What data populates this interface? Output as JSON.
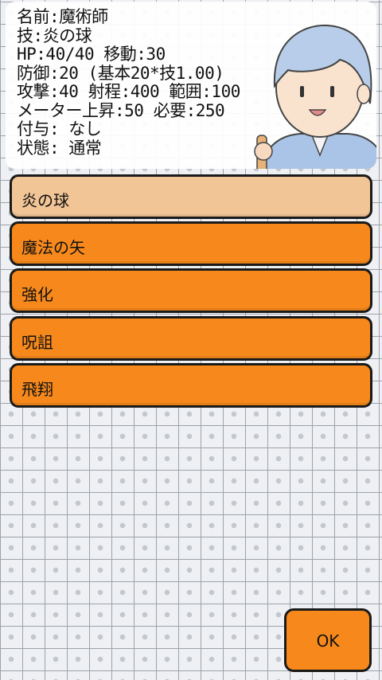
{
  "stats": [
    "名前:魔術師",
    "技:炎の球",
    "HP:40/40 移動:30",
    "防御:20 (基本20*技1.00)",
    "攻撃:40 射程:400 範囲:100",
    "メーター上昇:50 必要:250",
    "付与: なし",
    "状態: 通常"
  ],
  "skills": [
    {
      "label": "炎の球",
      "selected": true
    },
    {
      "label": "魔法の矢",
      "selected": false
    },
    {
      "label": "強化",
      "selected": false
    },
    {
      "label": "呪詛",
      "selected": false
    },
    {
      "label": "飛翔",
      "selected": false
    }
  ],
  "ok_label": "OK",
  "colors": {
    "button": "#f7891c",
    "button_selected": "#f2c596",
    "border": "#1a1a1a"
  }
}
